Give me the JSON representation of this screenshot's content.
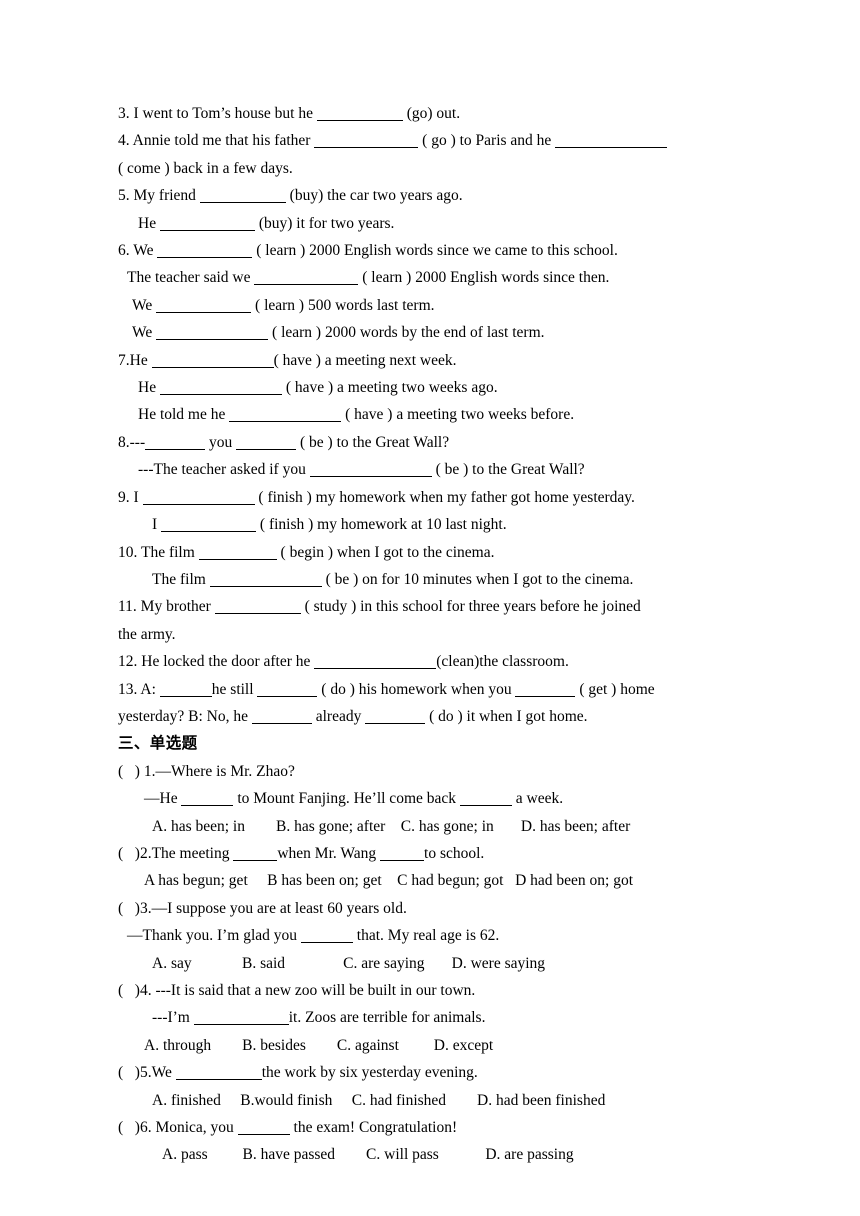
{
  "document": {
    "fill_in_blanks": {
      "items": [
        {
          "id": "q3",
          "indent": 0,
          "segments": [
            {
              "text": "3. I went to Tom’s house but he "
            },
            {
              "blank": 10
            },
            {
              "text": " (go) out."
            }
          ]
        },
        {
          "id": "q4",
          "indent": 0,
          "wrap": true,
          "segments": [
            {
              "text": "4. Annie told me that his father "
            },
            {
              "blank": 12
            },
            {
              "text": " ( go ) to Paris and he "
            },
            {
              "blank": 13
            }
          ],
          "tail": "( come ) back in a few days."
        },
        {
          "id": "q5",
          "indent": 0,
          "segments": [
            {
              "text": "5. My friend "
            },
            {
              "blank": 10
            },
            {
              "text": " (buy) the car two years ago."
            }
          ]
        },
        {
          "id": "q5b",
          "indent": 3,
          "segments": [
            {
              "text": "He "
            },
            {
              "blank": 11
            },
            {
              "text": " (buy) it for two years."
            }
          ]
        },
        {
          "id": "q6",
          "indent": 0,
          "segments": [
            {
              "text": "6. We "
            },
            {
              "blank": 11
            },
            {
              "text": " ( learn ) 2000 English words since we came to this school."
            }
          ]
        },
        {
          "id": "q6b",
          "indent": 1,
          "segments": [
            {
              "text": "The teacher said we "
            },
            {
              "blank": 12
            },
            {
              "text": " ( learn ) 2000 English words since then."
            }
          ]
        },
        {
          "id": "q6c",
          "indent": 2,
          "segments": [
            {
              "text": "We "
            },
            {
              "blank": 11
            },
            {
              "text": " ( learn ) 500 words last term."
            }
          ]
        },
        {
          "id": "q6d",
          "indent": 2,
          "segments": [
            {
              "text": "We "
            },
            {
              "blank": 13
            },
            {
              "text": " ( learn ) 2000 words by the end of last term."
            }
          ]
        },
        {
          "id": "q7",
          "indent": 0,
          "segments": [
            {
              "text": "7.He "
            },
            {
              "blank": 14
            },
            {
              "text": "( have ) a meeting next week."
            }
          ]
        },
        {
          "id": "q7b",
          "indent": 3,
          "segments": [
            {
              "text": "He "
            },
            {
              "blank": 14
            },
            {
              "text": " ( have ) a meeting two weeks ago."
            }
          ]
        },
        {
          "id": "q7c",
          "indent": 3,
          "segments": [
            {
              "text": "He told me he "
            },
            {
              "blank": 13
            },
            {
              "text": " ( have ) a meeting two weeks before."
            }
          ]
        },
        {
          "id": "q8",
          "indent": 0,
          "segments": [
            {
              "text": "8.---"
            },
            {
              "blank": 7
            },
            {
              "text": " you "
            },
            {
              "blank": 7
            },
            {
              "text": " ( be ) to the Great Wall?"
            }
          ]
        },
        {
          "id": "q8b",
          "indent": 3,
          "segments": [
            {
              "text": "---The teacher asked if you "
            },
            {
              "blank": 14
            },
            {
              "text": " ( be ) to the Great Wall?"
            }
          ]
        },
        {
          "id": "q9",
          "indent": 0,
          "segments": [
            {
              "text": "9. I "
            },
            {
              "blank": 13
            },
            {
              "text": " ( finish ) my homework when my father got home yesterday."
            }
          ]
        },
        {
          "id": "q9b",
          "indent": 5,
          "segments": [
            {
              "text": "I "
            },
            {
              "blank": 11
            },
            {
              "text": " ( finish ) my homework at 10 last night."
            }
          ]
        },
        {
          "id": "q10",
          "indent": 0,
          "segments": [
            {
              "text": "10. The film "
            },
            {
              "blank": 9
            },
            {
              "text": " ( begin ) when I got to the cinema."
            }
          ]
        },
        {
          "id": "q10b",
          "indent": 5,
          "segments": [
            {
              "text": "The film "
            },
            {
              "blank": 13
            },
            {
              "text": " ( be ) on for 10 minutes when I got to the cinema."
            }
          ]
        },
        {
          "id": "q11",
          "indent": 0,
          "wrap": true,
          "segments": [
            {
              "text": "11. My brother "
            },
            {
              "blank": 10
            },
            {
              "text": " ( study ) in this school for three years before he joined"
            }
          ],
          "tail": "the army."
        },
        {
          "id": "q12",
          "indent": 0,
          "segments": [
            {
              "text": "12. He locked the door after he "
            },
            {
              "blank": 14
            },
            {
              "text": "(clean)the classroom."
            }
          ]
        },
        {
          "id": "q13",
          "indent": 0,
          "wrap": true,
          "segments": [
            {
              "text": "13. A: "
            },
            {
              "blank": 6
            },
            {
              "text": "he still "
            },
            {
              "blank": 7
            },
            {
              "text": " ( do ) his homework when you "
            },
            {
              "blank": 7
            },
            {
              "text": " ( get ) home"
            }
          ],
          "tail_segments": [
            {
              "text": "yesterday?     B: No, he "
            },
            {
              "blank": 7
            },
            {
              "text": " already "
            },
            {
              "blank": 7
            },
            {
              "text": " ( do ) it when I got home."
            }
          ]
        }
      ]
    },
    "section_heading": "三、单选题",
    "multiple_choice": {
      "questions": [
        {
          "id": "mc1",
          "stem": [
            {
              "indent": 0,
              "segments": [
                {
                  "text": "(   ) 1.—Where is Mr. Zhao?"
                }
              ]
            },
            {
              "indent": 4,
              "segments": [
                {
                  "text": "—He "
                },
                {
                  "blank": 6
                },
                {
                  "text": " to Mount Fanjing. He’ll come back "
                },
                {
                  "blank": 6
                },
                {
                  "text": " a week."
                }
              ]
            }
          ],
          "options_indent": 5,
          "options_line": "A. has been; in        B. has gone; after    C. has gone; in       D. has been; after"
        },
        {
          "id": "mc2",
          "stem": [
            {
              "indent": 0,
              "segments": [
                {
                  "text": "(   )2.The meeting "
                },
                {
                  "blank": 5
                },
                {
                  "text": "when Mr. Wang "
                },
                {
                  "blank": 5
                },
                {
                  "text": "to school."
                }
              ]
            }
          ],
          "options_indent": 4,
          "options_line": "A has begun; get     B has been on; get    C had begun; got   D had been on; got"
        },
        {
          "id": "mc3",
          "stem": [
            {
              "indent": 0,
              "segments": [
                {
                  "text": "(   )3.—I suppose you are at least 60 years old."
                }
              ]
            },
            {
              "indent": 1,
              "segments": [
                {
                  "text": "—Thank you. I’m glad you "
                },
                {
                  "blank": 6
                },
                {
                  "text": " that. My real age is 62."
                }
              ]
            }
          ],
          "options_indent": 5,
          "options_line": "A. say             B. said               C. are saying       D. were saying"
        },
        {
          "id": "mc4",
          "stem": [
            {
              "indent": 0,
              "segments": [
                {
                  "text": "(   )4. ---It is said that a new zoo will be built in our town."
                }
              ]
            },
            {
              "indent": 5,
              "segments": [
                {
                  "text": "---I’m "
                },
                {
                  "blank": 11
                },
                {
                  "text": "it. Zoos are terrible for animals."
                }
              ]
            }
          ],
          "options_indent": 4,
          "options_line": "A. through        B. besides        C. against         D. except"
        },
        {
          "id": "mc5",
          "stem": [
            {
              "indent": 0,
              "segments": [
                {
                  "text": "(   )5.We "
                },
                {
                  "blank": 10
                },
                {
                  "text": "the work by six yesterday evening."
                }
              ]
            }
          ],
          "options_indent": 5,
          "options_line": "A. finished     B.would finish     C. had finished        D. had been finished"
        },
        {
          "id": "mc6",
          "stem": [
            {
              "indent": 0,
              "segments": [
                {
                  "text": "(   )6. Monica, you "
                },
                {
                  "blank": 6
                },
                {
                  "text": " the exam! Congratulation!"
                }
              ]
            }
          ],
          "options_indent": 6,
          "options_line": "A. pass         B. have passed        C. will pass            D. are passing"
        }
      ]
    }
  }
}
